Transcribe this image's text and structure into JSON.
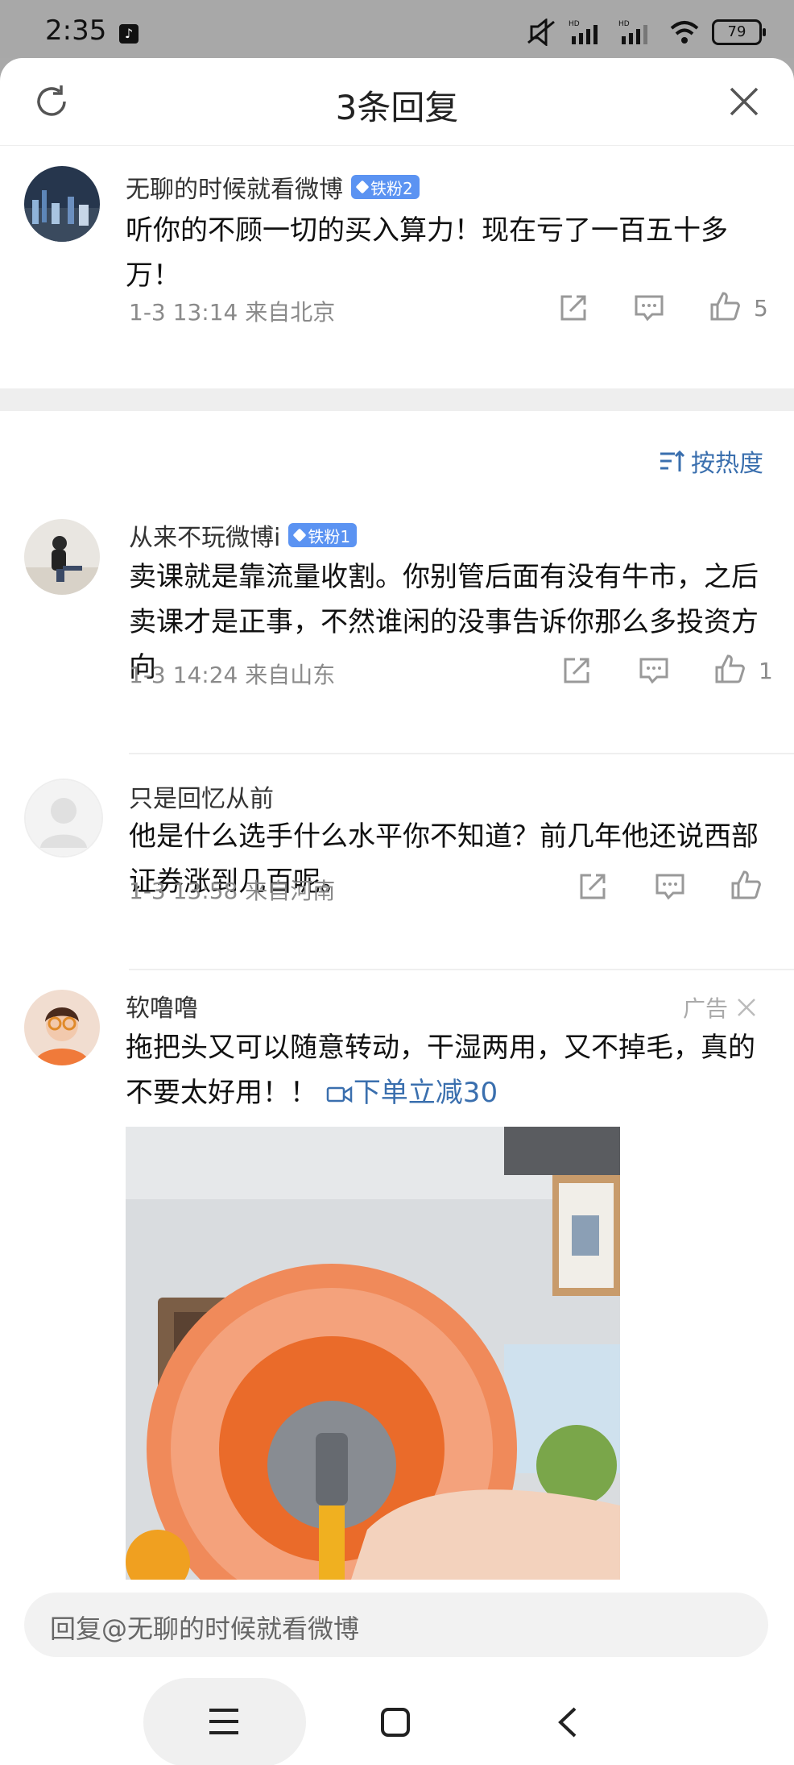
{
  "status_bar": {
    "time": "2:35",
    "battery": "79"
  },
  "header": {
    "title": "3条回复"
  },
  "comments": [
    {
      "user": "无聊的时候就看微博",
      "badge": "铁粉2",
      "text": "听你的不顾一切的买入算力！现在亏了一百五十多万！",
      "meta": "1-3 13:14  来自北京",
      "likes": "5"
    },
    {
      "user": "从来不玩微博i",
      "badge": "铁粉1",
      "text": "卖课就是靠流量收割。你别管后面有没有牛市，之后卖课才是正事，不然谁闲的没事告诉你那么多投资方向",
      "meta": "1-3 14:24  来自山东",
      "likes": "1"
    },
    {
      "user": "只是回忆从前",
      "text": "他是什么选手什么水平你不知道？前几年他还说西部证券涨到几百呢。",
      "meta": "1-3 13:58  来自河南"
    }
  ],
  "sort": {
    "label": "按热度"
  },
  "ad": {
    "user": "软噜噜",
    "label": "广告",
    "text": "拖把头又可以随意转动，干湿两用，又不掉毛，真的不要太好用！！",
    "link": "下单立减30"
  },
  "reply_bar": {
    "placeholder": "回复@无聊的时候就看微博"
  },
  "colors": {
    "accent": "#3a6fae",
    "badge": "#5b93f2",
    "mop_orange": "#f07a3a"
  },
  "icons": [
    "refresh-icon",
    "close-icon",
    "share-icon",
    "comment-icon",
    "like-icon",
    "sort-icon",
    "video-icon",
    "menu-icon",
    "home-icon",
    "back-icon"
  ]
}
